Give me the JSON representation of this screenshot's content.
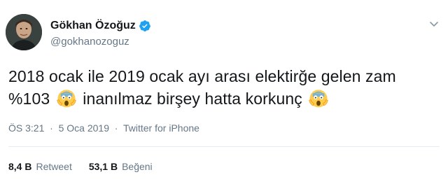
{
  "user": {
    "display_name": "Gökhan Özoğuz",
    "handle": "@gokhanozoguz",
    "verified": true
  },
  "tweet": {
    "line1": "2018 ocak ile 2019 ocak ayı arası elektirğe gelen zam",
    "line2_prefix": "%103",
    "line2_middle": "inanılmaz birşey hatta korkunç",
    "emoji_name": "face-screaming-in-fear"
  },
  "meta": {
    "time": "ÖS 3:21",
    "separator": "·",
    "date": "5 Oca 2019",
    "source": "Twitter for iPhone"
  },
  "stats": {
    "retweets_count": "8,4 B",
    "retweets_label": "Retweet",
    "likes_count": "53,1 B",
    "likes_label": "Beğeni"
  },
  "colors": {
    "text": "#14171a",
    "secondary": "#657786",
    "verified": "#1da1f2",
    "divider": "#e6ecf0"
  }
}
